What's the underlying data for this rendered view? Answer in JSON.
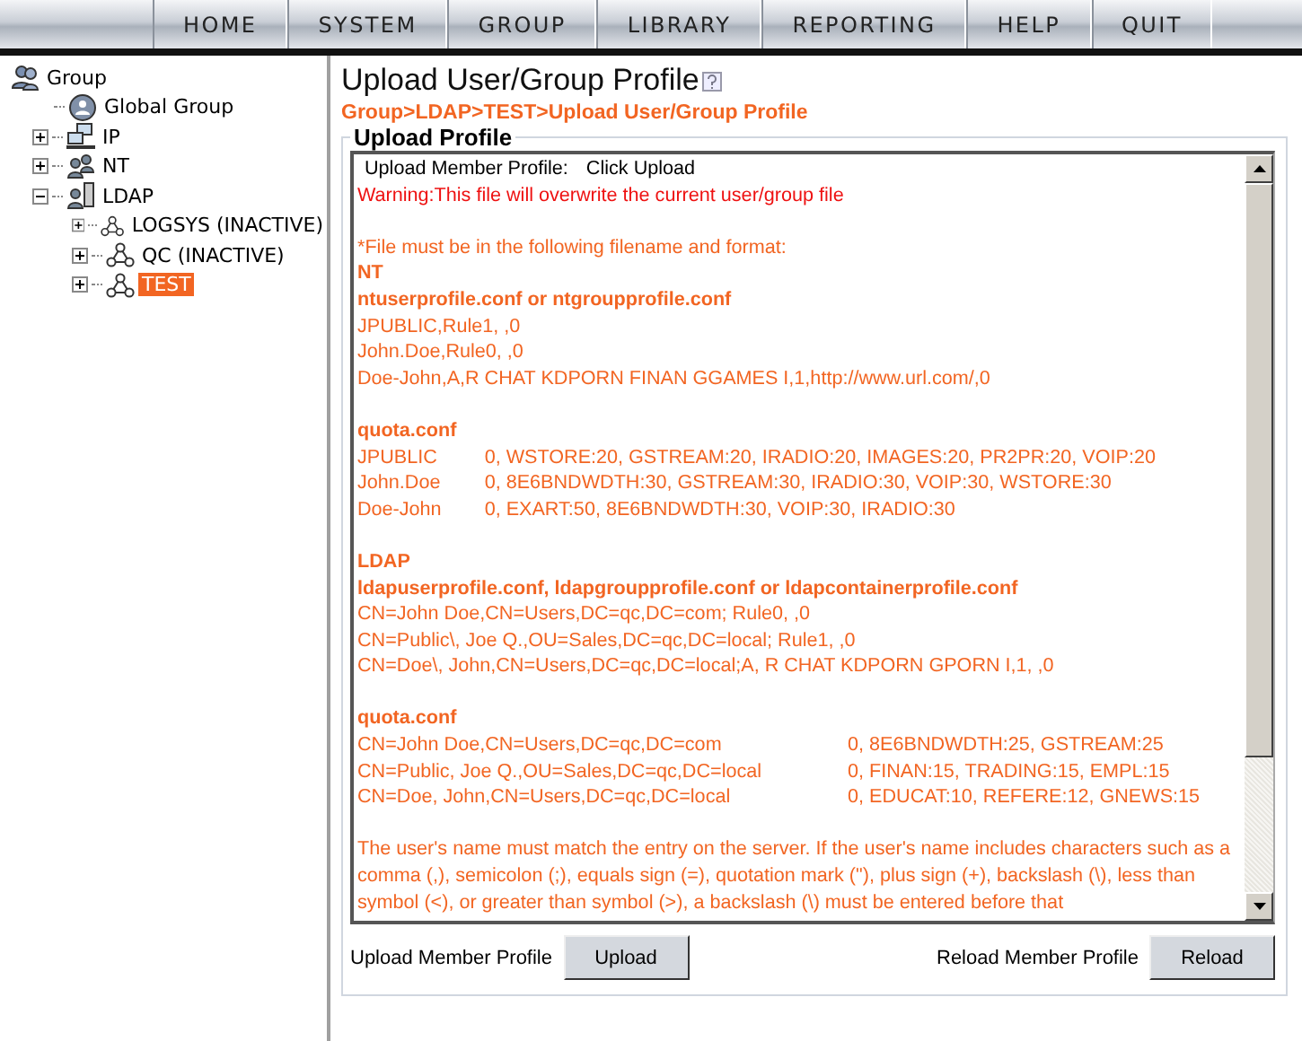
{
  "nav": [
    {
      "label": "HOME"
    },
    {
      "label": "SYSTEM"
    },
    {
      "label": "GROUP"
    },
    {
      "label": "LIBRARY"
    },
    {
      "label": "REPORTING"
    },
    {
      "label": "HELP"
    },
    {
      "label": "QUIT"
    }
  ],
  "tree": {
    "label": "Group",
    "kind": "root",
    "selected": false,
    "children": [
      {
        "label": "Global Group",
        "kind": "global",
        "selected": false
      },
      {
        "label": "IP",
        "kind": "ip",
        "expanded": false,
        "selected": false
      },
      {
        "label": "NT",
        "kind": "nt",
        "expanded": false,
        "selected": false
      },
      {
        "label": "LDAP",
        "kind": "ldap",
        "expanded": true,
        "selected": false,
        "children": [
          {
            "label": "LOGSYS (INACTIVE)",
            "kind": "node",
            "expanded": false,
            "selected": false
          },
          {
            "label": "QC (INACTIVE)",
            "kind": "node",
            "expanded": false,
            "selected": false
          },
          {
            "label": "TEST",
            "kind": "node",
            "expanded": false,
            "selected": true
          }
        ]
      }
    ]
  },
  "page": {
    "title": "Upload User/Group Profile",
    "breadcrumb": "Group>LDAP>TEST>Upload User/Group Profile",
    "legend": "Upload Profile"
  },
  "profile_text": [
    {
      "kind": "field",
      "label": "Upload Member Profile:",
      "value": "Click Upload"
    },
    {
      "kind": "warning",
      "text": "Warning:This file will overwrite the current user/group file"
    },
    {
      "kind": "blank"
    },
    {
      "kind": "line",
      "text": "*File must be in the following filename and format:"
    },
    {
      "kind": "heading",
      "text": "NT"
    },
    {
      "kind": "heading",
      "text": "ntuserprofile.conf or ntgroupprofile.conf"
    },
    {
      "kind": "line",
      "text": "JPUBLIC,Rule1, ,0"
    },
    {
      "kind": "line",
      "text": "John.Doe,Rule0, ,0"
    },
    {
      "kind": "line",
      "text": "Doe-John,A,R CHAT KDPORN FINAN GGAMES I,1,http://www.url.com/,0"
    },
    {
      "kind": "blank"
    },
    {
      "kind": "heading",
      "text": "quota.conf"
    },
    {
      "kind": "table",
      "rows": [
        [
          "JPUBLIC",
          "0, WSTORE:20, GSTREAM:20, IRADIO:20, IMAGES:20, PR2PR:20, VOIP:20"
        ],
        [
          "John.Doe",
          "0, 8E6BNDWDTH:30, GSTREAM:30, IRADIO:30, VOIP:30, WSTORE:30"
        ],
        [
          "Doe-John",
          "0, EXART:50, 8E6BNDWDTH:30, VOIP:30, IRADIO:30"
        ]
      ]
    },
    {
      "kind": "blank"
    },
    {
      "kind": "heading",
      "text": "LDAP"
    },
    {
      "kind": "heading",
      "text": "ldapuserprofile.conf, ldapgroupprofile.conf or ldapcontainerprofile.conf"
    },
    {
      "kind": "line",
      "text": "CN=John Doe,CN=Users,DC=qc,DC=com; Rule0, ,0"
    },
    {
      "kind": "line",
      "text": "CN=Public\\, Joe Q.,OU=Sales,DC=qc,DC=local; Rule1, ,0"
    },
    {
      "kind": "line",
      "text": "CN=Doe\\, John,CN=Users,DC=qc,DC=local;A, R CHAT KDPORN GPORN I,1, ,0"
    },
    {
      "kind": "blank"
    },
    {
      "kind": "heading",
      "text": "quota.conf"
    },
    {
      "kind": "table",
      "rows": [
        [
          "CN=John Doe,CN=Users,DC=qc,DC=com",
          "0, 8E6BNDWDTH:25, GSTREAM:25"
        ],
        [
          "CN=Public, Joe Q.,OU=Sales,DC=qc,DC=local",
          "0, FINAN:15, TRADING:15, EMPL:15"
        ],
        [
          "CN=Doe, John,CN=Users,DC=qc,DC=local",
          "0, EDUCAT:10, REFERE:12, GNEWS:15"
        ]
      ]
    },
    {
      "kind": "blank"
    },
    {
      "kind": "line",
      "text": "The user's name must match the entry on the server. If the user's name includes characters such as a comma (,), semicolon (;), equals sign (=), quotation mark (\"), plus sign (+), backslash (\\), less than symbol (<), or greater than symbol (>), a backslash (\\) must be entered before that"
    }
  ],
  "actions": [
    {
      "label": "Upload Member Profile",
      "button": "Upload"
    },
    {
      "label": "Reload Member Profile",
      "button": "Reload"
    }
  ]
}
